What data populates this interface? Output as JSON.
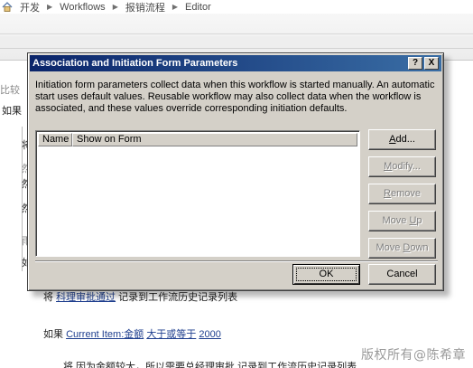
{
  "breadcrumb": {
    "items": [
      "开发",
      "Workflows",
      "报销流程",
      "Editor"
    ],
    "separator": "▶"
  },
  "background": {
    "edge_texts": [
      "比较",
      "如果"
    ],
    "side_fragments": [
      "将",
      "然",
      "然",
      "然",
      "雨",
      "如"
    ],
    "line_action": {
      "prefix": "将",
      "link": "科理审批通过",
      "suffix": "记录到工作流历史记录列表"
    },
    "condition": {
      "keyword": "如果",
      "field": "Current Item:金额",
      "operator": "大于或等于",
      "value": "2000"
    },
    "last_line": "将 因为金额较大，所以需要总经理审批 记录到工作流历史记录列表",
    "watermark": "版权所有@陈希章"
  },
  "dialog": {
    "title": "Association and Initiation Form Parameters",
    "help_button": "?",
    "close_button": "X",
    "description": "Initiation form parameters collect data when this workflow is started manually. An automatic start uses default values. Reusable workflow may also collect data when the workflow is associated, and these values override corresponding initiation defaults.",
    "columns": [
      "Name",
      "Show on Form"
    ],
    "side_buttons": {
      "add": {
        "mnemonic": "A",
        "rest": "dd..."
      },
      "modify": {
        "mnemonic": "M",
        "rest": "odify..."
      },
      "remove": {
        "mnemonic": "R",
        "rest": "emove"
      },
      "move_up": {
        "pre": "Move ",
        "mnemonic": "U",
        "rest": "p"
      },
      "move_down": {
        "pre": "Move ",
        "mnemonic": "D",
        "rest": "own"
      }
    },
    "ok_label": "OK",
    "cancel_label": "Cancel"
  },
  "colors": {
    "title_bar_start": "#0a246a",
    "title_bar_end": "#3a6ea5",
    "dialog_face": "#d4d0c8",
    "link": "#1f3f8f"
  },
  "icons": {
    "breadcrumb_home": "home-icon",
    "breadcrumb_separator": "chevron-right-icon"
  }
}
